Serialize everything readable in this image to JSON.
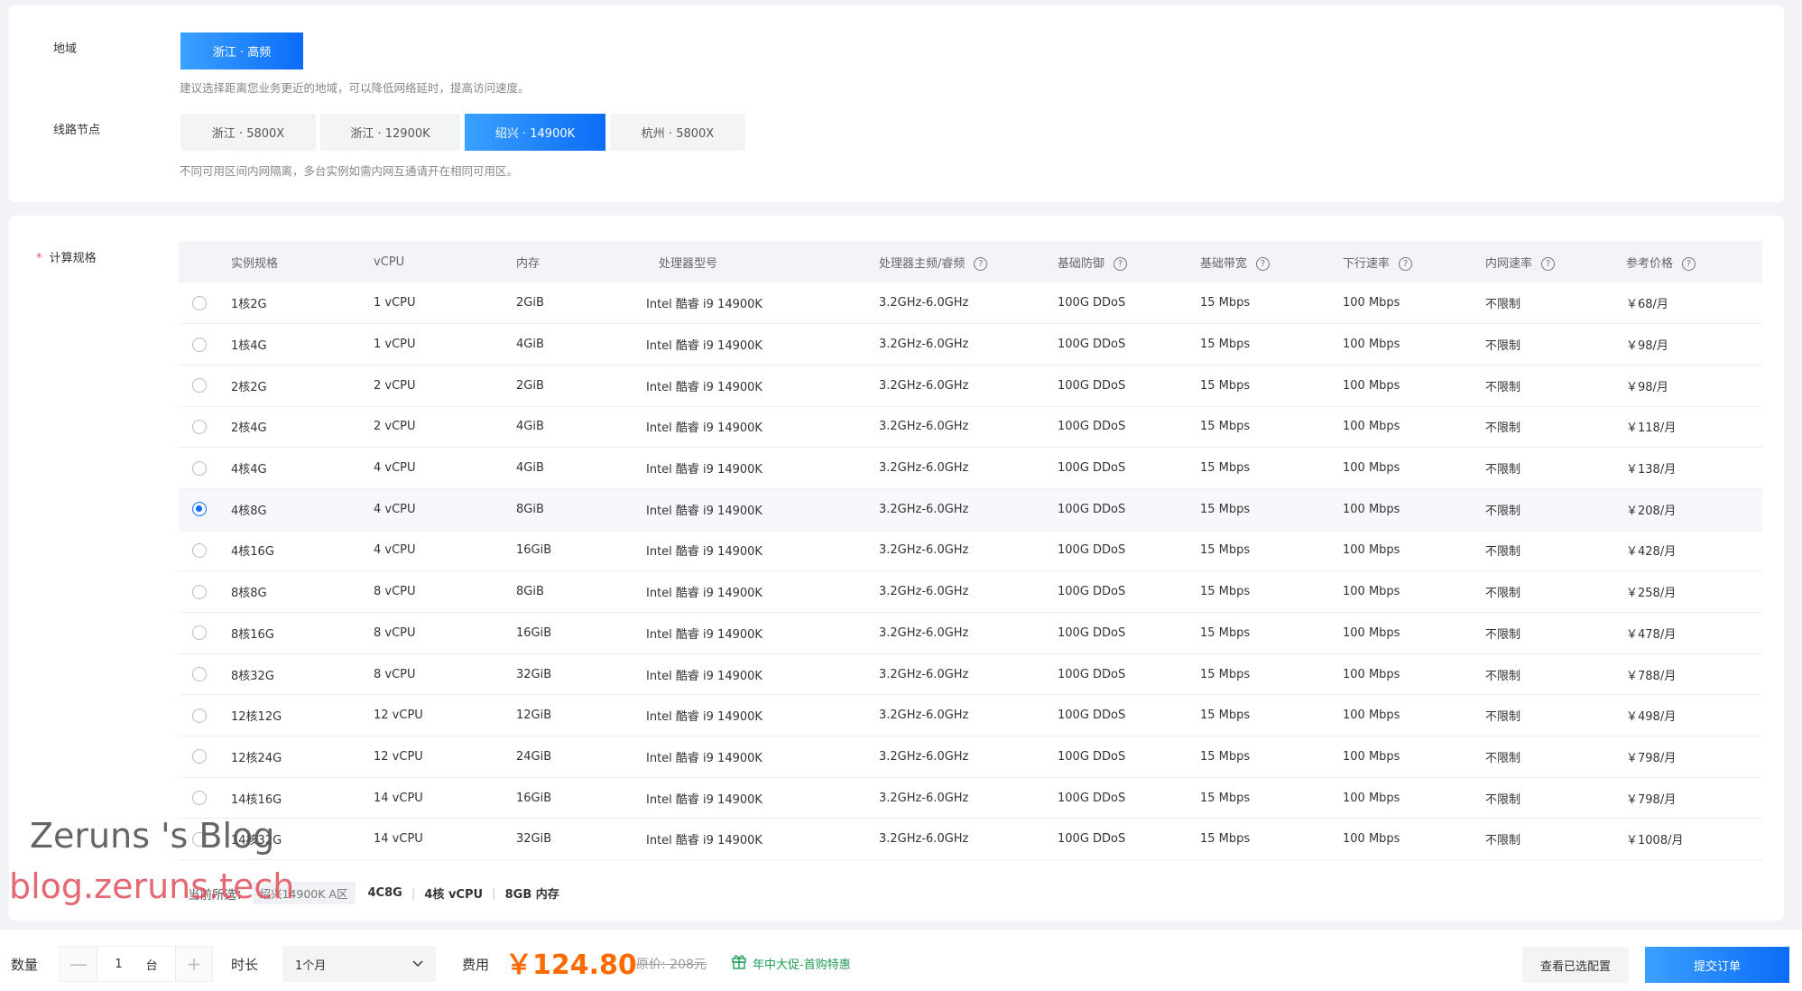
{
  "region": {
    "label": "地域",
    "options": [
      "浙江 · 高频"
    ],
    "selected": 0,
    "hint": "建议选择距离您业务更近的地域，可以降低网络延时，提高访问速度。"
  },
  "node": {
    "label": "线路节点",
    "options": [
      "浙江 · 5800X",
      "浙江 · 12900K",
      "绍兴 · 14900K",
      "杭州 · 5800X"
    ],
    "selected": 2,
    "hint": "不同可用区间内网隔离，多台实例如需内网互通请开在相同可用区。"
  },
  "spec": {
    "required_mark": "*",
    "label": "计算规格",
    "columns": [
      "实例规格",
      "vCPU",
      "内存",
      "处理器型号",
      "处理器主频/睿频",
      "基础防御",
      "基础带宽",
      "下行速率",
      "内网速率",
      "参考价格"
    ],
    "selected_row": 5,
    "rows": [
      {
        "name": "1核2G",
        "vcpu": "1 vCPU",
        "mem": "2GiB",
        "cpu": "Intel 酷睿 i9 14900K",
        "freq": "3.2GHz-6.0GHz",
        "ddos": "100G DDoS",
        "bw": "15 Mbps",
        "down": "100 Mbps",
        "lan": "不限制",
        "price": "￥68/月"
      },
      {
        "name": "1核4G",
        "vcpu": "1 vCPU",
        "mem": "4GiB",
        "cpu": "Intel 酷睿 i9 14900K",
        "freq": "3.2GHz-6.0GHz",
        "ddos": "100G DDoS",
        "bw": "15 Mbps",
        "down": "100 Mbps",
        "lan": "不限制",
        "price": "￥98/月"
      },
      {
        "name": "2核2G",
        "vcpu": "2 vCPU",
        "mem": "2GiB",
        "cpu": "Intel 酷睿 i9 14900K",
        "freq": "3.2GHz-6.0GHz",
        "ddos": "100G DDoS",
        "bw": "15 Mbps",
        "down": "100 Mbps",
        "lan": "不限制",
        "price": "￥98/月"
      },
      {
        "name": "2核4G",
        "vcpu": "2 vCPU",
        "mem": "4GiB",
        "cpu": "Intel 酷睿 i9 14900K",
        "freq": "3.2GHz-6.0GHz",
        "ddos": "100G DDoS",
        "bw": "15 Mbps",
        "down": "100 Mbps",
        "lan": "不限制",
        "price": "￥118/月"
      },
      {
        "name": "4核4G",
        "vcpu": "4 vCPU",
        "mem": "4GiB",
        "cpu": "Intel 酷睿 i9 14900K",
        "freq": "3.2GHz-6.0GHz",
        "ddos": "100G DDoS",
        "bw": "15 Mbps",
        "down": "100 Mbps",
        "lan": "不限制",
        "price": "￥138/月"
      },
      {
        "name": "4核8G",
        "vcpu": "4 vCPU",
        "mem": "8GiB",
        "cpu": "Intel 酷睿 i9 14900K",
        "freq": "3.2GHz-6.0GHz",
        "ddos": "100G DDoS",
        "bw": "15 Mbps",
        "down": "100 Mbps",
        "lan": "不限制",
        "price": "￥208/月"
      },
      {
        "name": "4核16G",
        "vcpu": "4 vCPU",
        "mem": "16GiB",
        "cpu": "Intel 酷睿 i9 14900K",
        "freq": "3.2GHz-6.0GHz",
        "ddos": "100G DDoS",
        "bw": "15 Mbps",
        "down": "100 Mbps",
        "lan": "不限制",
        "price": "￥428/月"
      },
      {
        "name": "8核8G",
        "vcpu": "8 vCPU",
        "mem": "8GiB",
        "cpu": "Intel 酷睿 i9 14900K",
        "freq": "3.2GHz-6.0GHz",
        "ddos": "100G DDoS",
        "bw": "15 Mbps",
        "down": "100 Mbps",
        "lan": "不限制",
        "price": "￥258/月"
      },
      {
        "name": "8核16G",
        "vcpu": "8 vCPU",
        "mem": "16GiB",
        "cpu": "Intel 酷睿 i9 14900K",
        "freq": "3.2GHz-6.0GHz",
        "ddos": "100G DDoS",
        "bw": "15 Mbps",
        "down": "100 Mbps",
        "lan": "不限制",
        "price": "￥478/月"
      },
      {
        "name": "8核32G",
        "vcpu": "8 vCPU",
        "mem": "32GiB",
        "cpu": "Intel 酷睿 i9 14900K",
        "freq": "3.2GHz-6.0GHz",
        "ddos": "100G DDoS",
        "bw": "15 Mbps",
        "down": "100 Mbps",
        "lan": "不限制",
        "price": "￥788/月"
      },
      {
        "name": "12核12G",
        "vcpu": "12 vCPU",
        "mem": "12GiB",
        "cpu": "Intel 酷睿 i9 14900K",
        "freq": "3.2GHz-6.0GHz",
        "ddos": "100G DDoS",
        "bw": "15 Mbps",
        "down": "100 Mbps",
        "lan": "不限制",
        "price": "￥498/月"
      },
      {
        "name": "12核24G",
        "vcpu": "12 vCPU",
        "mem": "24GiB",
        "cpu": "Intel 酷睿 i9 14900K",
        "freq": "3.2GHz-6.0GHz",
        "ddos": "100G DDoS",
        "bw": "15 Mbps",
        "down": "100 Mbps",
        "lan": "不限制",
        "price": "￥798/月"
      },
      {
        "name": "14核16G",
        "vcpu": "14 vCPU",
        "mem": "16GiB",
        "cpu": "Intel 酷睿 i9 14900K",
        "freq": "3.2GHz-6.0GHz",
        "ddos": "100G DDoS",
        "bw": "15 Mbps",
        "down": "100 Mbps",
        "lan": "不限制",
        "price": "￥798/月"
      },
      {
        "name": "14核32G",
        "vcpu": "14 vCPU",
        "mem": "32GiB",
        "cpu": "Intel 酷睿 i9 14900K",
        "freq": "3.2GHz-6.0GHz",
        "ddos": "100G DDoS",
        "bw": "15 Mbps",
        "down": "100 Mbps",
        "lan": "不限制",
        "price": "￥1008/月"
      }
    ]
  },
  "summary": {
    "label": "当前所选：",
    "zone": "绍兴14900K A区",
    "items": [
      "4C8G",
      "4核 vCPU",
      "8GB 内存"
    ],
    "separator": "|"
  },
  "bottom": {
    "quantity_label": "数量",
    "quantity_value": "1",
    "quantity_unit": "台",
    "minus": "—",
    "plus": "+",
    "duration_label": "时长",
    "duration_value": "1个月",
    "fee_label": "费用",
    "fee_value": "￥124.80",
    "original_price": "原价: 208元",
    "promo": "年中大促-首购特惠",
    "view_button": "查看已选配置",
    "submit_button": "提交订单"
  },
  "watermark": {
    "title": "Zeruns 's Blog",
    "url": "blog.zeruns.tech"
  },
  "colors": {
    "accent": "#0b6cf7",
    "price": "#ff6a00",
    "promo": "#1f9d55"
  }
}
